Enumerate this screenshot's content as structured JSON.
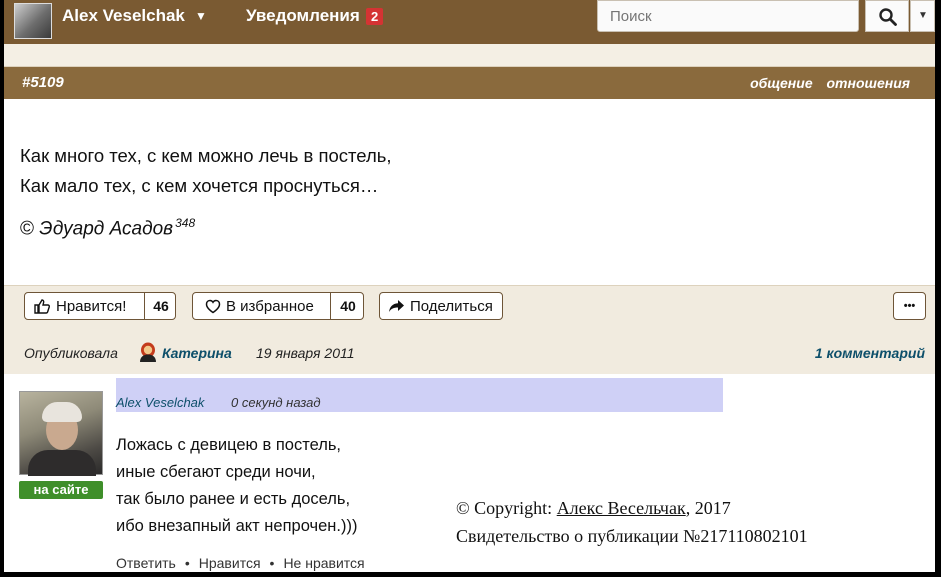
{
  "topbar": {
    "username": "Alex Veselchak",
    "notifications_label": "Уведомления",
    "notifications_count": "2",
    "search_placeholder": "Поиск"
  },
  "card": {
    "number": "#5109",
    "tags": [
      "общение",
      "отношения"
    ],
    "quote_lines": [
      "Как много тех, с кем можно лечь в постель,",
      "Как мало тех, с кем хочется проснуться…"
    ],
    "copyright_sign": "©",
    "author": "Эдуард Асадов",
    "author_count": "348"
  },
  "actions": {
    "like_label": "Нравится!",
    "like_count": "46",
    "fav_label": "В избранное",
    "fav_count": "40",
    "share_label": "Поделиться",
    "more_label": "•••"
  },
  "published": {
    "label": "Опубликовала",
    "author": "Катерина",
    "date": "19 января 2011",
    "comments": "1 комментарий"
  },
  "comment": {
    "author": "Alex Veselchak",
    "time": "0 секунд назад",
    "online_label": "на сайте",
    "lines": [
      "Ложась с девицею в постель,",
      "иные сбегают среди ночи,",
      "так было ранее и есть досель,",
      "ибо внезапный акт непрочен.)))"
    ],
    "reply": "Ответить",
    "like": "Нравится",
    "dislike": "Не нравится"
  },
  "copyright": {
    "prefix": "© Copyright:",
    "author_link": "Алекс Весельчак",
    "year": ", 2017",
    "certificate": "Свидетельство о публикации №217110802101"
  }
}
